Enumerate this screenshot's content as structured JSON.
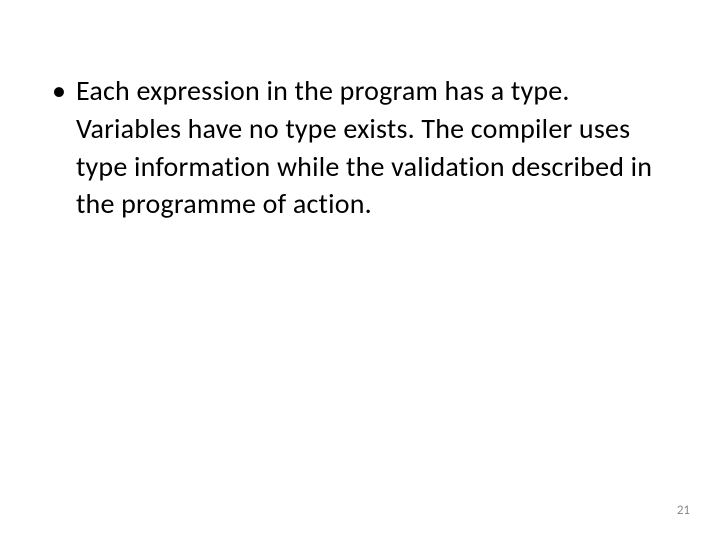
{
  "slide": {
    "bullets": [
      {
        "text": "Each expression in the program has a type. Variables have no type exists. The compiler uses type information while the validation described in the programme of action."
      }
    ],
    "page_number": "21"
  }
}
